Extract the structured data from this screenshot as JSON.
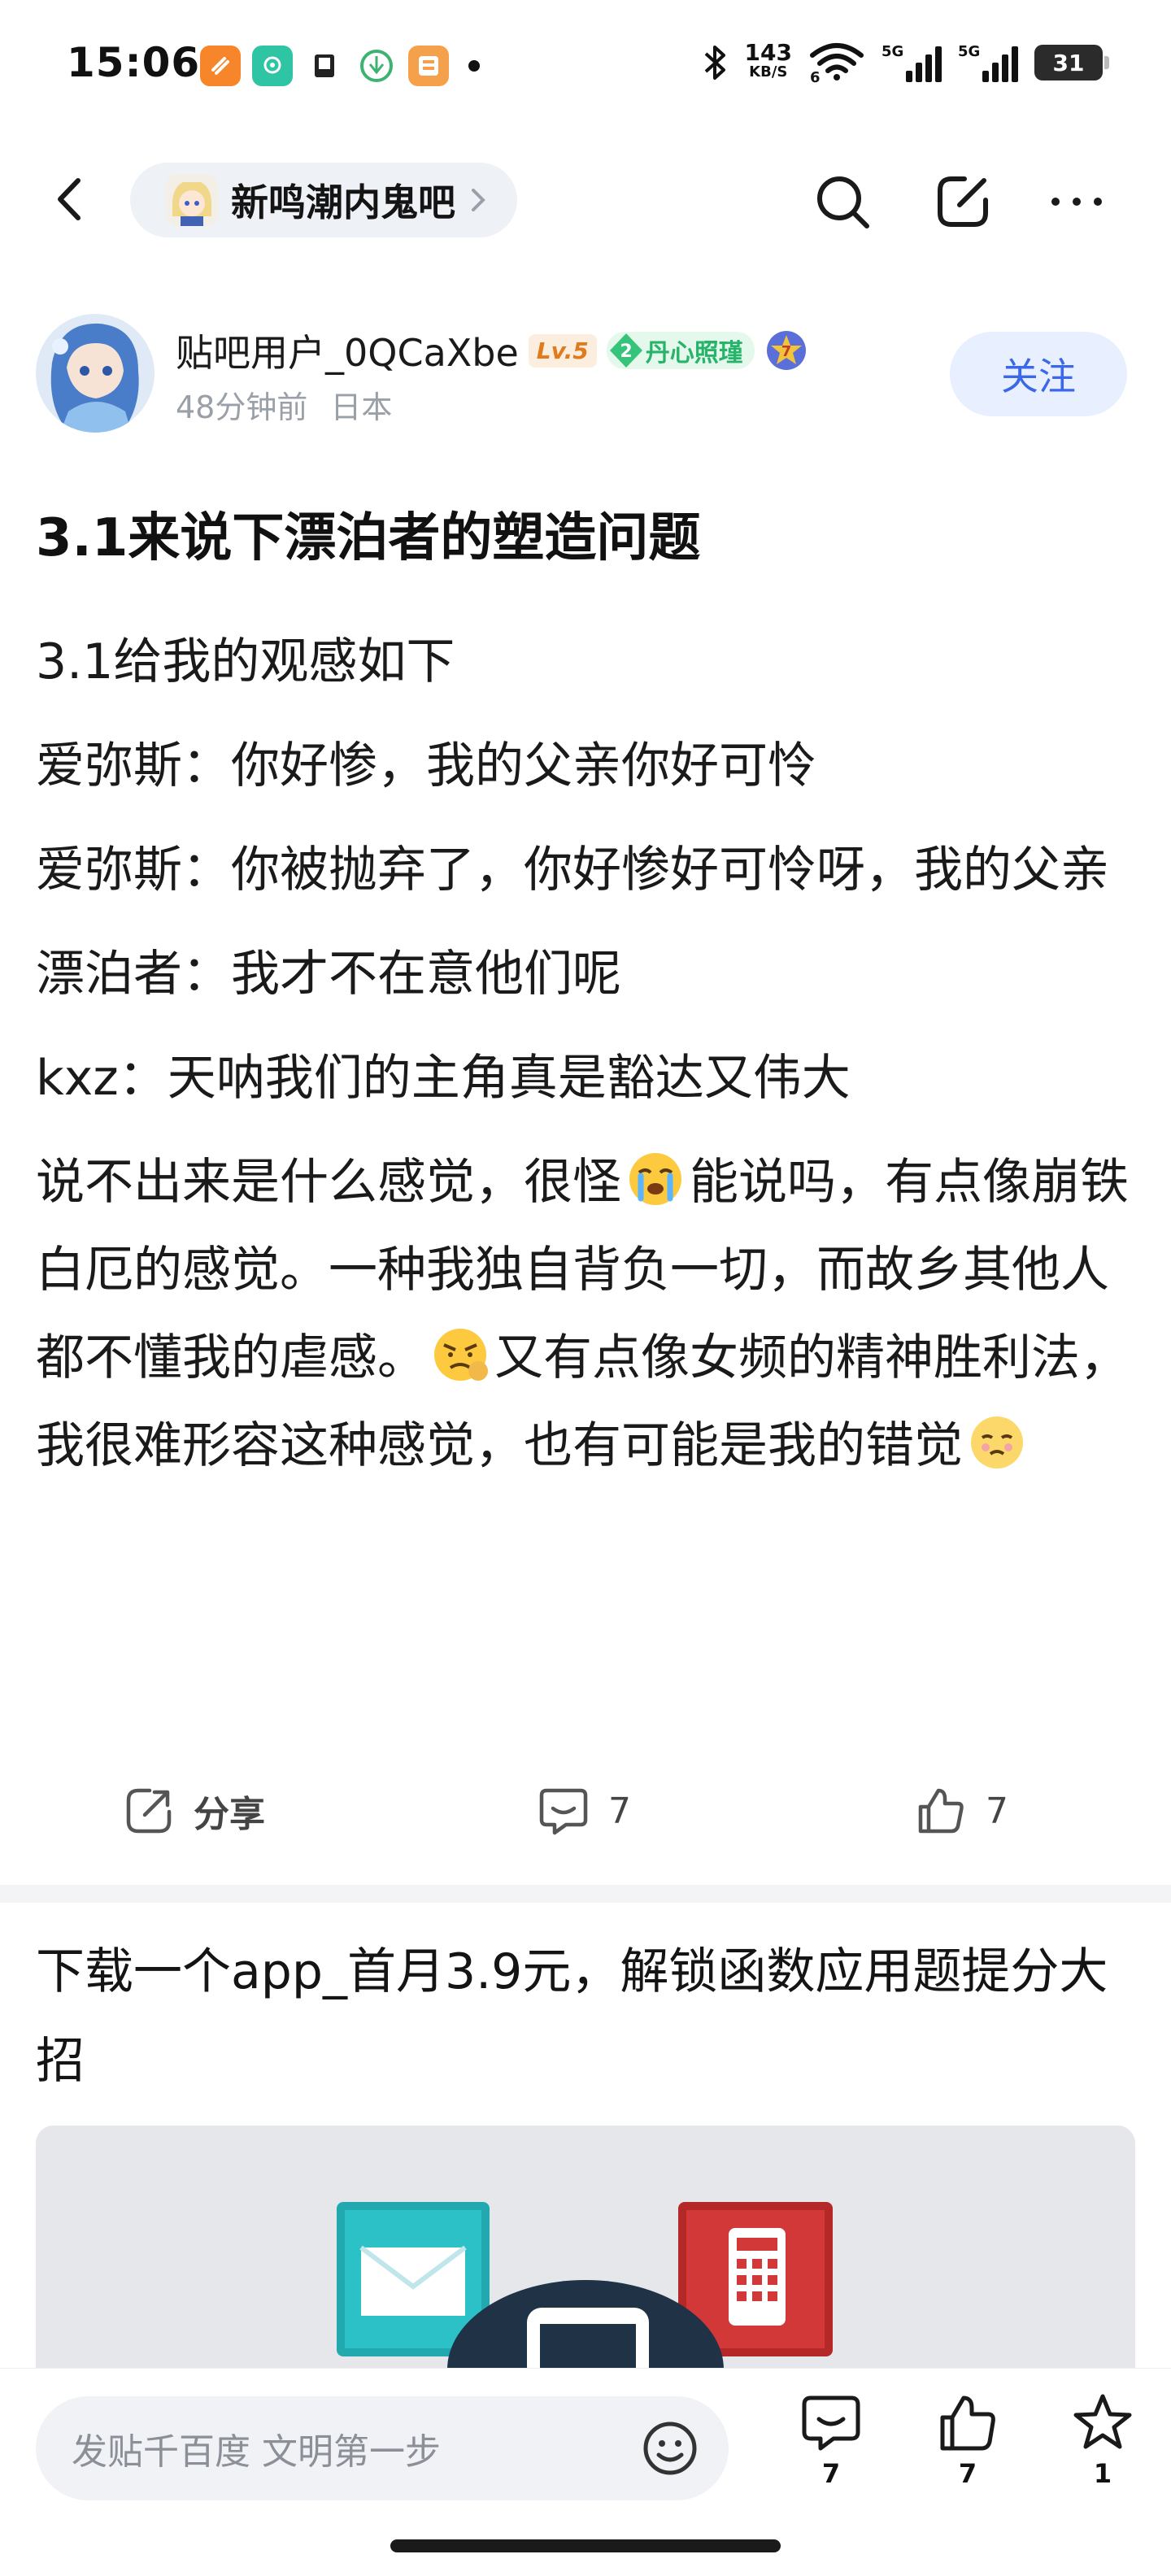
{
  "status_bar": {
    "time": "15:06",
    "net_speed_value": "143",
    "net_speed_unit": "KB/S",
    "wifi_label": "6",
    "sim1_label": "5G",
    "sim2_label": "5G",
    "battery": "31"
  },
  "nav": {
    "forum_name": "新鸣潮内鬼吧"
  },
  "author": {
    "username": "贴吧用户_0QCaXbe",
    "level": "Lv.5",
    "badge_number": "2",
    "badge_text": "丹心照瑾",
    "star_badge_number": "7",
    "time_ago": "48分钟前",
    "location": "日本",
    "follow_label": "关注"
  },
  "post": {
    "title": "3.1来说下漂泊者的塑造问题",
    "lines": {
      "l1": "3.1给我的观感如下",
      "l2": "爱弥斯：你好惨，我的父亲你好可怜",
      "l3": "爱弥斯：你被抛弃了，你好惨好可怜呀，我的父亲",
      "l4": "漂泊者：我才不在意他们呢",
      "l5": "kxz：天呐我们的主角真是豁达又伟大",
      "l6a": "说不出来是什么感觉，很怪",
      "l6b": "能说吗，有点像崩铁白厄的感觉。一种我独自背负一切，而故乡其他人都不懂我的虐感。",
      "l6c": "又有点像女频的精神胜利法，我很难形容这种感觉，也有可能是我的错觉"
    },
    "emoji_icons": [
      "crying-emoji",
      "grimace-emoji",
      "teary-emoji"
    ]
  },
  "actions": {
    "share_label": "分享",
    "comment_count": "7",
    "like_count": "7"
  },
  "ad": {
    "title": "下载一个app_首月3.9元，解锁函数应用题提分大招"
  },
  "bottom_bar": {
    "reply_placeholder": "发贴千百度 文明第一步",
    "comment_count": "7",
    "like_count": "7",
    "favorite_count": "1"
  },
  "colors": {
    "accent_blue": "#3a68e8",
    "follow_bg": "#e8efff",
    "badge_green": "#27b46a",
    "level_orange": "#e07a1a"
  }
}
